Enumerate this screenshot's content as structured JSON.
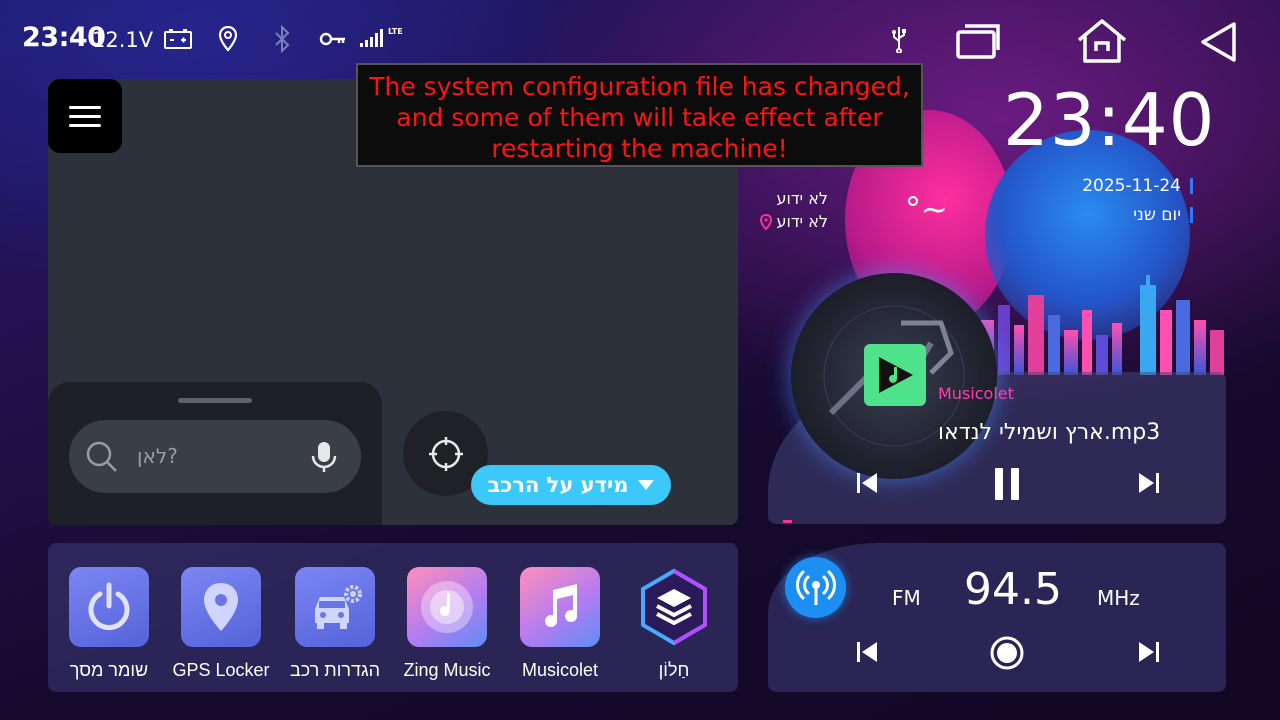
{
  "status_bar": {
    "time": "23:40",
    "voltage": "12.1V",
    "network": "LTE",
    "icons": [
      "battery-icon",
      "location-icon",
      "bluetooth-icon",
      "key-icon",
      "signal-icon",
      "usb-icon",
      "recents-icon",
      "home-icon",
      "back-icon"
    ]
  },
  "toast": {
    "message": "The system configuration file has changed, and some of them will take effect after restarting the machine!",
    "color": "#ff1414"
  },
  "navigation": {
    "search_placeholder": "לאן?",
    "vehicle_info_label": "מידע על הרכב"
  },
  "clock_widget": {
    "time": "23:40",
    "date": "2025-11-24",
    "day": "יום שני",
    "weather_condition": "לא ידוע",
    "weather_location": "לא ידוע",
    "temperature": "°~"
  },
  "music_widget": {
    "app_name": "Musicolet",
    "track": "ארץ ושמילי לנדאו.mp3",
    "progress": 0.02
  },
  "radio_widget": {
    "band": "FM",
    "frequency": "94.5",
    "unit": "MHz"
  },
  "dock": {
    "apps": [
      {
        "label": "שומר מסך",
        "icon": "power-icon"
      },
      {
        "label": "GPS Locker",
        "icon": "location-pin-icon"
      },
      {
        "label": "הגדרות רכב",
        "icon": "car-settings-icon"
      },
      {
        "label": "Zing Music",
        "icon": "disc-note-icon"
      },
      {
        "label": "Musicolet",
        "icon": "music-note-icon"
      },
      {
        "label": "חַלוֹן",
        "icon": "layers-icon"
      }
    ]
  },
  "colors": {
    "accent_blue": "#3cc8f8",
    "accent_pink": "#ff2f9e",
    "map_bg": "#2c313c"
  }
}
